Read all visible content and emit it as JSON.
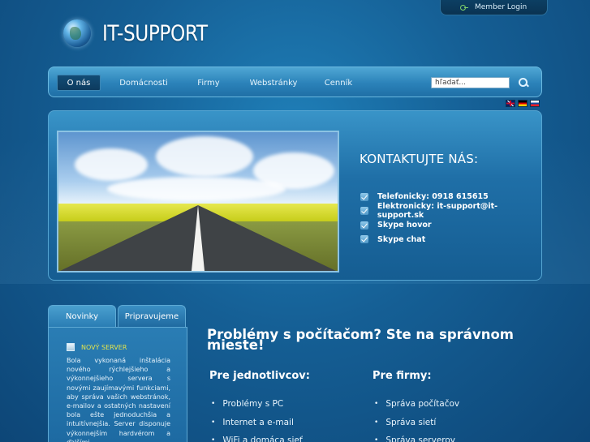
{
  "header": {
    "member_login": "Member Login",
    "logo_text": "IT-SUPPORT"
  },
  "nav": {
    "items": [
      {
        "label": "O nás",
        "active": true
      },
      {
        "label": "Domácnosti",
        "active": false
      },
      {
        "label": "Firmy",
        "active": false
      },
      {
        "label": "Webstránky",
        "active": false
      },
      {
        "label": "Cenník",
        "active": false
      }
    ],
    "search_placeholder": "hľadať..."
  },
  "languages": [
    "en-flag-icon",
    "de-flag-icon",
    "sk-flag-icon"
  ],
  "hero": {
    "contact_title": "KONTAKTUJTE NÁS:",
    "contacts": [
      "Telefonicky: 0918 615615",
      "Elektronicky: it-support@it-support.sk",
      "Skype hovor",
      "Skype chat"
    ],
    "slider_dots": 4,
    "active_dot": 1
  },
  "sidebar": {
    "tabs": [
      {
        "label": "Novinky",
        "active": true
      },
      {
        "label": "Pripravujeme",
        "active": false
      }
    ],
    "news": {
      "title": "NOVÝ SERVER",
      "text": "Bola vykonaná inštalácia nového rýchlejšieho a výkonnejšieho servera s novými zaujímavými funkciami, aby správa vašich webstránok, e-mailov a ostatných nastavení bola ešte jednoduchšia a intuitívnejšia. Server disponuje výkonnejším hardvérom a ďalšími"
    }
  },
  "main": {
    "heading": "Problémy s počítačom? Ste na správnom mieste!",
    "individuals": {
      "title": "Pre jednotlivcov:",
      "items": [
        "Problémy s PC",
        "Internet a e-mail",
        "WiFi a domáca sieť"
      ]
    },
    "companies": {
      "title": "Pre firmy:",
      "items": [
        "Správa počítačov",
        "Správa sietí",
        "Správa serverov"
      ]
    }
  },
  "colors": {
    "background": "#155f95",
    "navbar": "#2b82b9",
    "news_title": "#e3e44c"
  }
}
